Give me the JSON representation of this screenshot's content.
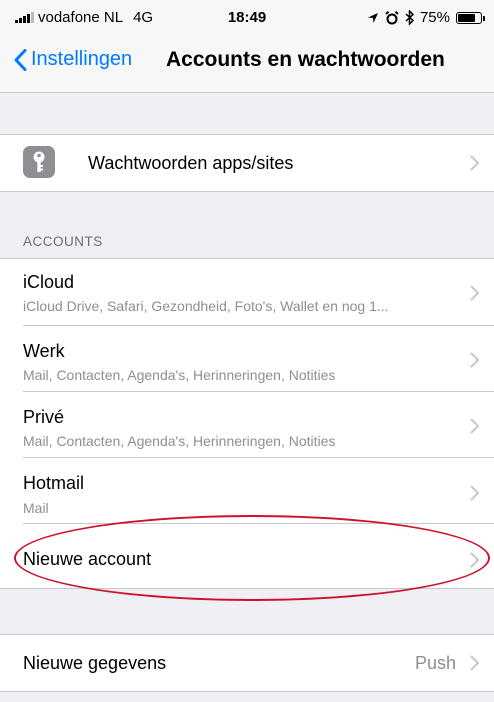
{
  "status_bar": {
    "carrier": "vodafone NL",
    "network": "4G",
    "time": "18:49",
    "battery": "75%",
    "battery_level": 0.75,
    "icons": [
      "signal-icon",
      "location-icon",
      "alarm-icon",
      "bluetooth-icon",
      "battery-icon"
    ]
  },
  "nav": {
    "back_label": "Instellingen",
    "title": "Accounts en wachtwoorden"
  },
  "passwords_row": {
    "label": "Wachtwoorden apps/sites",
    "icon": "key-icon"
  },
  "accounts_section": {
    "header": "ACCOUNTS",
    "items": [
      {
        "title": "iCloud",
        "subtitle": "iCloud Drive, Safari, Gezondheid, Foto's, Wallet en nog 1..."
      },
      {
        "title": "Werk",
        "subtitle": "Mail, Contacten, Agenda's, Herinneringen, Notities"
      },
      {
        "title": "Privé",
        "subtitle": "Mail, Contacten, Agenda's, Herinneringen, Notities"
      },
      {
        "title": "Hotmail",
        "subtitle": "Mail"
      }
    ],
    "add_account": "Nieuwe account"
  },
  "fetch_row": {
    "label": "Nieuwe gegevens",
    "value": "Push"
  },
  "colors": {
    "accent": "#007aff",
    "annotation": "#d0112b",
    "background": "#efeff4"
  }
}
